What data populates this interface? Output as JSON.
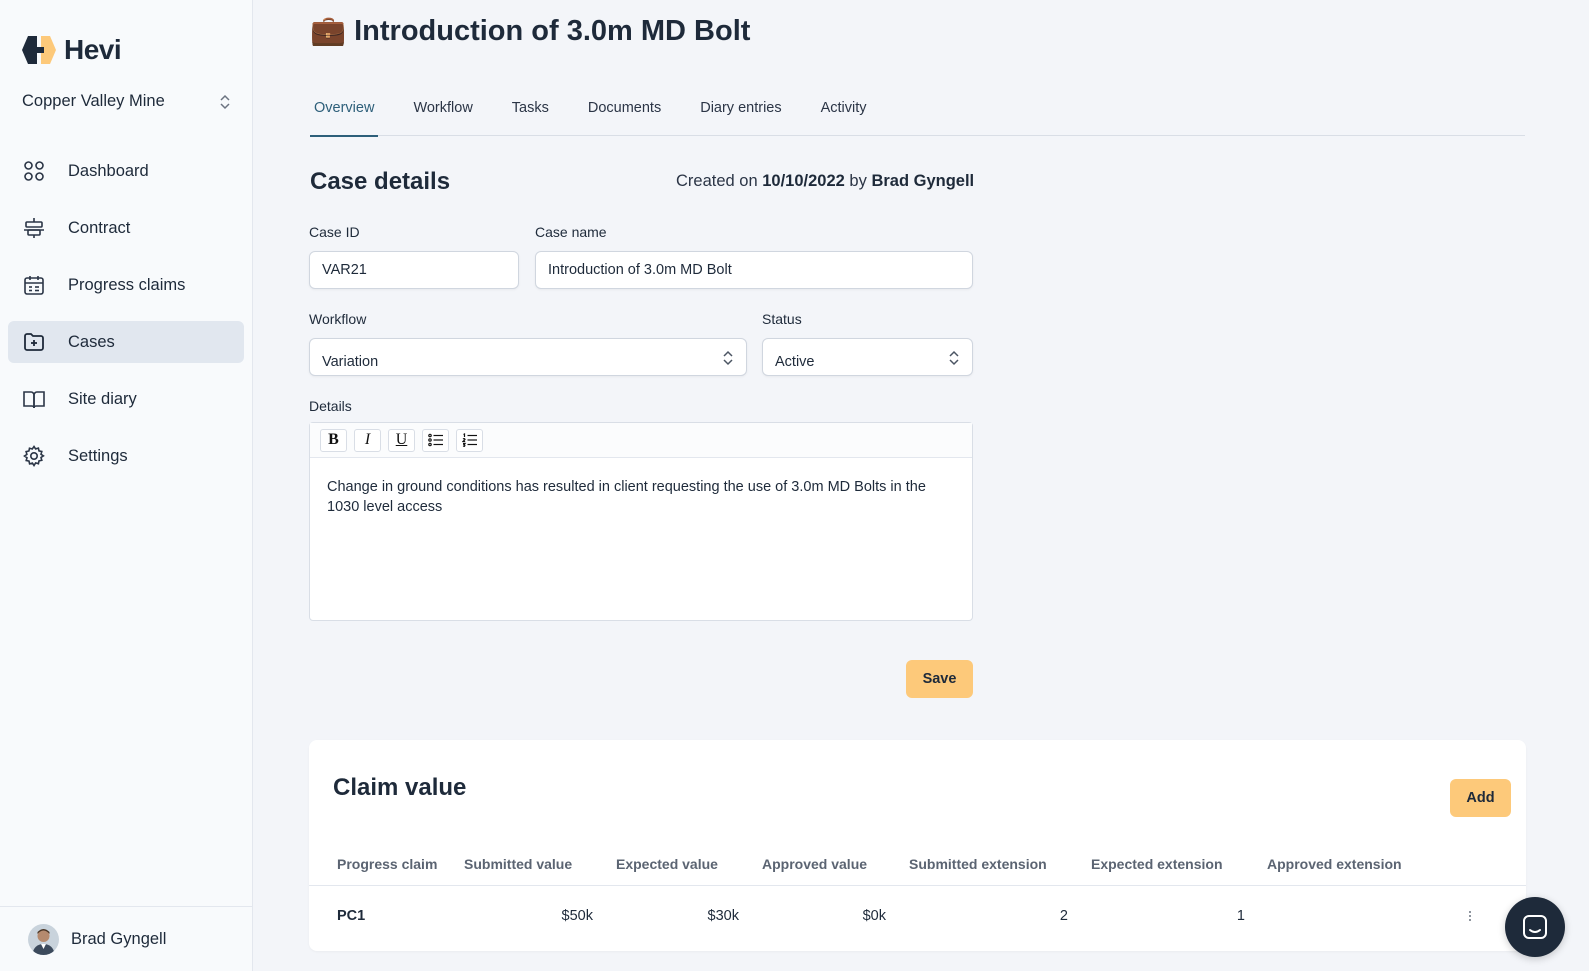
{
  "app": {
    "logo_text": "Hevi",
    "brand_colors": {
      "primary": "#fdc97a",
      "dark": "#1e2a3a",
      "accent": "#2d5f7a"
    }
  },
  "sidebar": {
    "org": "Copper Valley Mine",
    "items": [
      {
        "label": "Dashboard",
        "icon": "grid-icon"
      },
      {
        "label": "Contract",
        "icon": "contract-icon"
      },
      {
        "label": "Progress claims",
        "icon": "calendar-icon"
      },
      {
        "label": "Cases",
        "icon": "folder-plus-icon",
        "active": true
      },
      {
        "label": "Site diary",
        "icon": "book-icon"
      },
      {
        "label": "Settings",
        "icon": "gear-icon"
      }
    ],
    "user": "Brad Gyngell"
  },
  "page": {
    "title_emoji": "💼",
    "title": "Introduction of 3.0m MD Bolt",
    "tabs": [
      "Overview",
      "Workflow",
      "Tasks",
      "Documents",
      "Diary entries",
      "Activity"
    ],
    "active_tab": "Overview"
  },
  "case_details": {
    "heading": "Case details",
    "created_prefix": "Created on",
    "created_date": "10/10/2022",
    "created_by_word": "by",
    "created_by": "Brad Gyngell",
    "case_id_label": "Case ID",
    "case_id": "VAR21",
    "case_name_label": "Case name",
    "case_name": "Introduction of 3.0m MD Bolt",
    "workflow_label": "Workflow",
    "workflow": "Variation",
    "status_label": "Status",
    "status": "Active",
    "details_label": "Details",
    "toolbar": [
      "B",
      "I",
      "U"
    ],
    "details_text": "Change in ground conditions has resulted in client requesting the use of 3.0m MD Bolts in the 1030 level access",
    "save_label": "Save"
  },
  "claim_value": {
    "heading": "Claim value",
    "add_label": "Add",
    "columns": [
      "Progress claim",
      "Submitted value",
      "Expected value",
      "Approved value",
      "Submitted extension",
      "Expected extension",
      "Approved extension"
    ],
    "rows": [
      {
        "claim": "PC1",
        "submitted_value": "$50k",
        "expected_value": "$30k",
        "approved_value": "$0k",
        "submitted_extension": "2",
        "expected_extension": "1",
        "approved_extension": ""
      }
    ]
  }
}
